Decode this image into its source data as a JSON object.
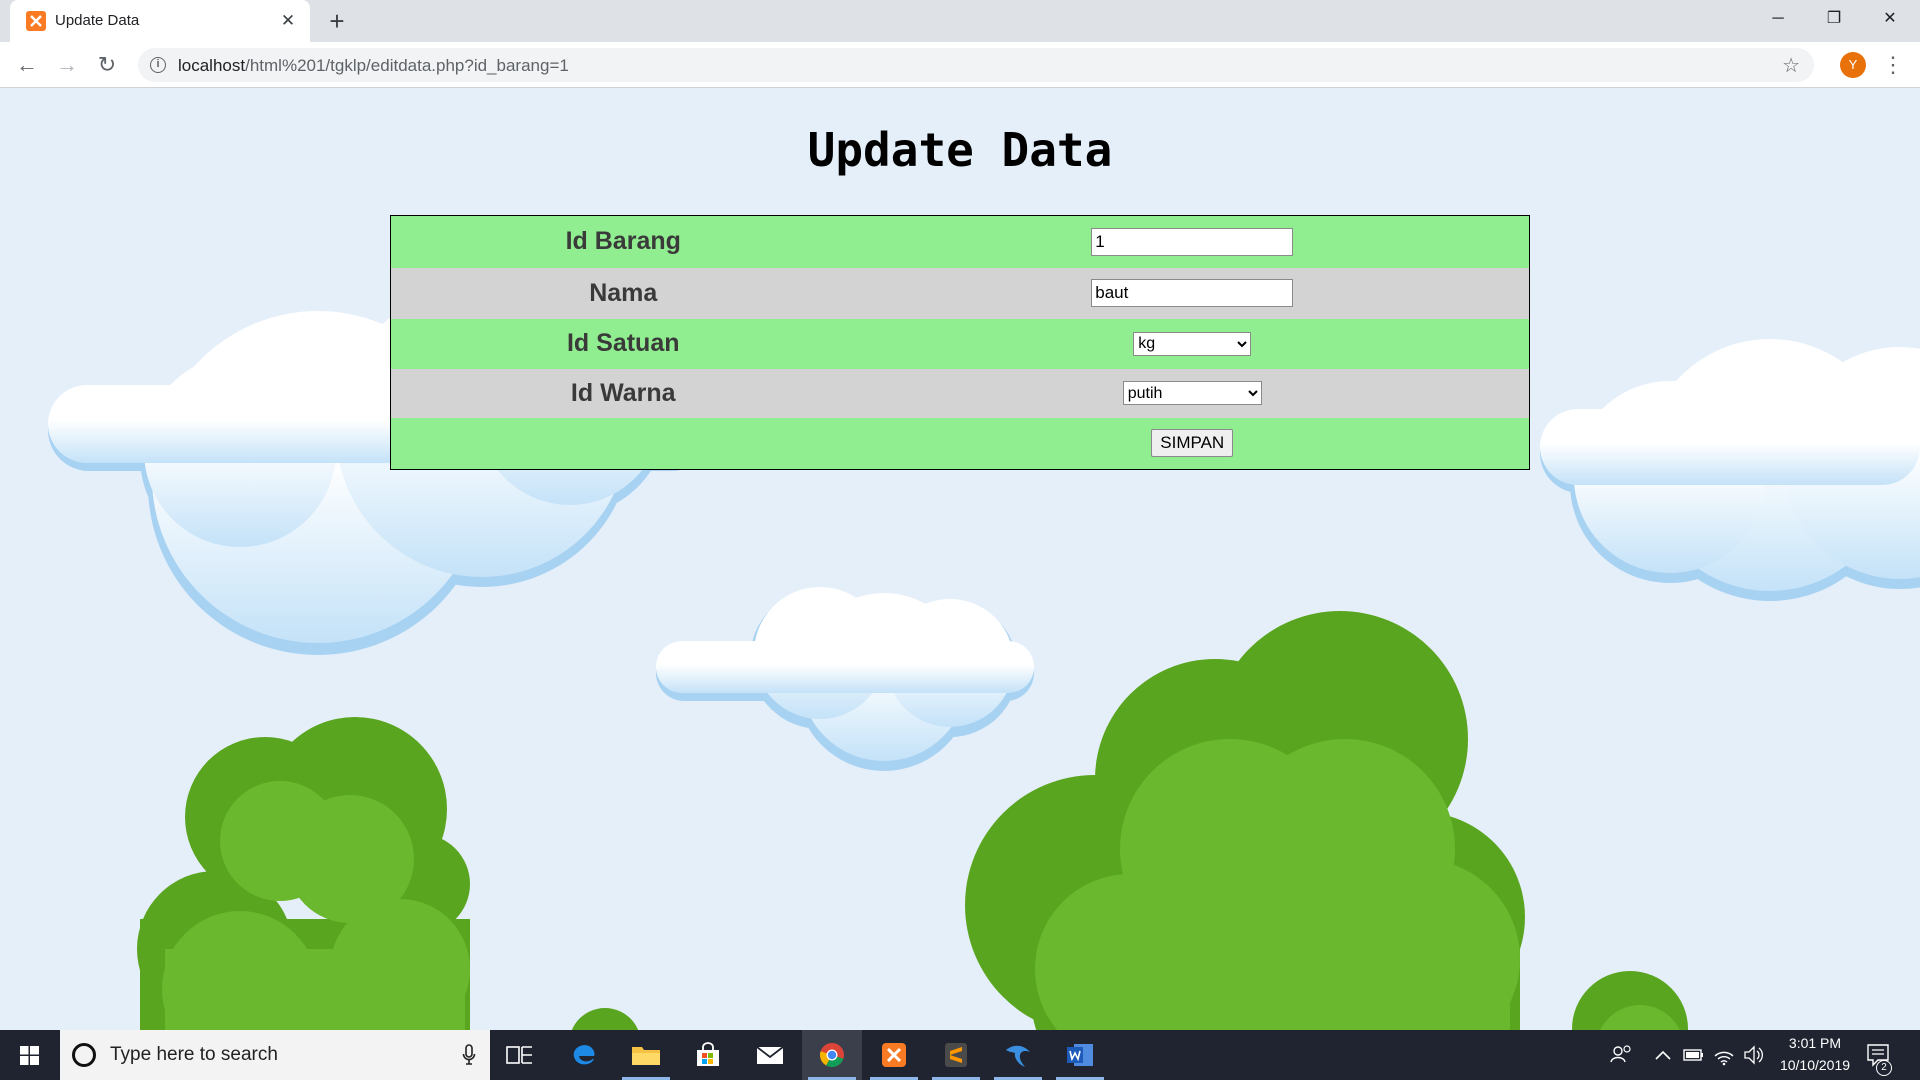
{
  "browser": {
    "tab_title": "Update Data",
    "tab_close": "✕",
    "new_tab": "+",
    "url_host": "localhost",
    "url_path": "/html%201/tgklp/editdata.php?id_barang=1",
    "profile_initial": "Y",
    "window_controls": {
      "minimize": "─",
      "restore": "❐",
      "close": "✕"
    },
    "icons": [
      "xampp-icon",
      "back-icon",
      "forward-icon",
      "reload-icon",
      "info-icon",
      "star-icon",
      "menu-icon"
    ]
  },
  "page": {
    "title": "Update Data",
    "form": {
      "id_barang": {
        "label": "Id Barang",
        "value": "1"
      },
      "nama": {
        "label": "Nama",
        "value": "baut"
      },
      "id_satuan": {
        "label": "Id Satuan",
        "selected": "kg"
      },
      "id_warna": {
        "label": "Id Warna",
        "selected": "putih"
      },
      "submit_label": "SIMPAN"
    },
    "colors": {
      "row_green": "#90ee90",
      "row_gray": "#d3d3d3",
      "sky": "#e5effa",
      "bush": "#6ab82d"
    }
  },
  "taskbar": {
    "search_placeholder": "Type here to search",
    "clock_time": "3:01 PM",
    "clock_date": "10/10/2019",
    "notification_count": "2",
    "apps": [
      "task-view-icon",
      "edge-icon",
      "file-explorer-icon",
      "store-icon",
      "mail-icon",
      "chrome-icon",
      "xampp-icon",
      "sublime-icon",
      "mysql-icon",
      "word-icon"
    ]
  }
}
